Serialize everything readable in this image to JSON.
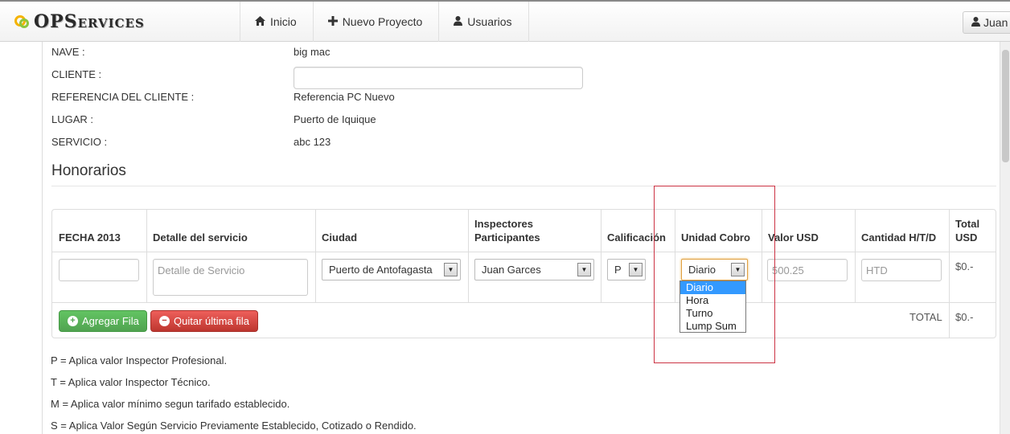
{
  "navbar": {
    "brand": "OPServices",
    "items": [
      {
        "label": "Inicio",
        "icon": "home-icon"
      },
      {
        "label": "Nuevo Proyecto",
        "icon": "plus-icon"
      },
      {
        "label": "Usuarios",
        "icon": "user-icon"
      }
    ],
    "user": "Juan"
  },
  "info": {
    "nave_label": "NAVE :",
    "nave_value": "big mac",
    "cliente_label": "CLIENTE :",
    "cliente_value": "",
    "referencia_label": "REFERENCIA DEL CLIENTE :",
    "referencia_value": "Referencia PC Nuevo",
    "lugar_label": "LUGAR :",
    "lugar_value": "Puerto de Iquique",
    "servicio_label": "SERVICIO :",
    "servicio_value": "abc 123"
  },
  "section_title": "Honorarios",
  "table": {
    "headers": {
      "fecha": "FECHA 2013",
      "detalle": "Detalle del servicio",
      "ciudad": "Ciudad",
      "inspectores_1": "Inspectores",
      "inspectores_2": "Participantes",
      "calificacion": "Calificación",
      "unidad": "Unidad Cobro",
      "valor": "Valor USD",
      "cantidad": "Cantidad H/T/D",
      "total_1": "Total",
      "total_2": "USD"
    },
    "row": {
      "fecha_value": "",
      "detalle_placeholder": "Detalle de Servicio",
      "ciudad_value": "Puerto de Antofagasta",
      "inspector_value": "Juan Garces",
      "calificacion_value": "P",
      "unidad_value": "Diario",
      "valor_placeholder": "500.25",
      "cantidad_placeholder": "HTD",
      "total_value": "$0.-"
    },
    "add_row_label": "Agregar Fila",
    "remove_row_label": "Quitar última fila",
    "total_label": "TOTAL",
    "grand_total": "$0.-"
  },
  "dropdown": {
    "options": [
      "Diario",
      "Hora",
      "Turno",
      "Lump Sum"
    ],
    "selected": "Diario"
  },
  "legend": [
    "P = Aplica valor Inspector Profesional.",
    "T = Aplica valor Inspector Técnico.",
    "M = Aplica valor mínimo segun tarifado establecido.",
    "S = Aplica Valor Según Servicio Previamente Establecido, Cotizado o Rendido."
  ]
}
